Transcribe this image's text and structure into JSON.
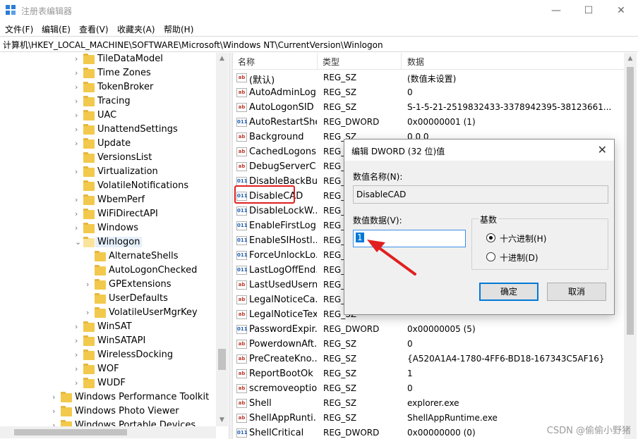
{
  "window": {
    "title": "注册表编辑器",
    "minimize": "—",
    "maximize": "☐",
    "close": "✕"
  },
  "menu": [
    "文件(F)",
    "编辑(E)",
    "查看(V)",
    "收藏夹(A)",
    "帮助(H)"
  ],
  "address": "计算机\\HKEY_LOCAL_MACHINE\\SOFTWARE\\Microsoft\\Windows NT\\CurrentVersion\\Winlogon",
  "tree": [
    {
      "label": "TileDataModel",
      "depth": 2,
      "expandable": true
    },
    {
      "label": "Time Zones",
      "depth": 2,
      "expandable": true
    },
    {
      "label": "TokenBroker",
      "depth": 2,
      "expandable": true
    },
    {
      "label": "Tracing",
      "depth": 2,
      "expandable": true
    },
    {
      "label": "UAC",
      "depth": 2,
      "expandable": true
    },
    {
      "label": "UnattendSettings",
      "depth": 2,
      "expandable": true
    },
    {
      "label": "Update",
      "depth": 2,
      "expandable": true
    },
    {
      "label": "VersionsList",
      "depth": 2,
      "expandable": false
    },
    {
      "label": "Virtualization",
      "depth": 2,
      "expandable": true
    },
    {
      "label": "VolatileNotifications",
      "depth": 2,
      "expandable": false
    },
    {
      "label": "WbemPerf",
      "depth": 2,
      "expandable": true
    },
    {
      "label": "WiFiDirectAPI",
      "depth": 2,
      "expandable": true
    },
    {
      "label": "Windows",
      "depth": 2,
      "expandable": true
    },
    {
      "label": "Winlogon",
      "depth": 2,
      "expandable": true,
      "expanded": true,
      "selected": true
    },
    {
      "label": "AlternateShells",
      "depth": 3,
      "expandable": false
    },
    {
      "label": "AutoLogonChecked",
      "depth": 3,
      "expandable": false
    },
    {
      "label": "GPExtensions",
      "depth": 3,
      "expandable": true
    },
    {
      "label": "UserDefaults",
      "depth": 3,
      "expandable": false
    },
    {
      "label": "VolatileUserMgrKey",
      "depth": 3,
      "expandable": true
    },
    {
      "label": "WinSAT",
      "depth": 2,
      "expandable": true
    },
    {
      "label": "WinSATAPI",
      "depth": 2,
      "expandable": true
    },
    {
      "label": "WirelessDocking",
      "depth": 2,
      "expandable": true
    },
    {
      "label": "WOF",
      "depth": 2,
      "expandable": true
    },
    {
      "label": "WUDF",
      "depth": 2,
      "expandable": true
    },
    {
      "label": "Windows Performance Toolkit",
      "depth": 1,
      "expandable": true
    },
    {
      "label": "Windows Photo Viewer",
      "depth": 1,
      "expandable": true
    },
    {
      "label": "Windows Portable Devices",
      "depth": 1,
      "expandable": true
    }
  ],
  "list": {
    "headers": {
      "name": "名称",
      "type": "类型",
      "data": "数据"
    },
    "rows": [
      {
        "name": "(默认)",
        "type": "REG_SZ",
        "data": "(数值未设置)",
        "kind": "sz"
      },
      {
        "name": "AutoAdminLog...",
        "type": "REG_SZ",
        "data": "0",
        "kind": "sz"
      },
      {
        "name": "AutoLogonSID",
        "type": "REG_SZ",
        "data": "S-1-5-21-2519832433-3378942395-38123661...",
        "kind": "sz"
      },
      {
        "name": "AutoRestartShell",
        "type": "REG_DWORD",
        "data": "0x00000001 (1)",
        "kind": "bin"
      },
      {
        "name": "Background",
        "type": "REG_SZ",
        "data": "0 0 0",
        "kind": "sz"
      },
      {
        "name": "CachedLogons...",
        "type": "REG_SZ",
        "data": "",
        "kind": "sz"
      },
      {
        "name": "DebugServerC...",
        "type": "REG_SZ",
        "data": "",
        "kind": "sz"
      },
      {
        "name": "DisableBackBu...",
        "type": "REG_DWORD",
        "data": "",
        "kind": "bin"
      },
      {
        "name": "DisableCAD",
        "type": "REG_DWORD",
        "data": "",
        "kind": "bin"
      },
      {
        "name": "DisableLockW...",
        "type": "REG_DWORD",
        "data": "",
        "kind": "bin"
      },
      {
        "name": "EnableFirstLog...",
        "type": "REG_DWORD",
        "data": "",
        "kind": "bin"
      },
      {
        "name": "EnableSIHostl...",
        "type": "REG_DWORD",
        "data": "",
        "kind": "bin"
      },
      {
        "name": "ForceUnlockLo...",
        "type": "REG_DWORD",
        "data": "",
        "kind": "bin"
      },
      {
        "name": "LastLogOffEnd...",
        "type": "REG_QWORD",
        "data": "",
        "kind": "bin"
      },
      {
        "name": "LastUsedUsern...",
        "type": "REG_SZ",
        "data": "",
        "kind": "sz"
      },
      {
        "name": "LegalNoticeCa...",
        "type": "REG_SZ",
        "data": "",
        "kind": "sz"
      },
      {
        "name": "LegalNoticeText",
        "type": "REG_SZ",
        "data": "",
        "kind": "sz"
      },
      {
        "name": "PasswordExpir...",
        "type": "REG_DWORD",
        "data": "0x00000005 (5)",
        "kind": "bin"
      },
      {
        "name": "PowerdownAft...",
        "type": "REG_SZ",
        "data": "0",
        "kind": "sz"
      },
      {
        "name": "PreCreateKno...",
        "type": "REG_SZ",
        "data": "{A520A1A4-1780-4FF6-BD18-167343C5AF16}",
        "kind": "sz"
      },
      {
        "name": "ReportBootOk",
        "type": "REG_SZ",
        "data": "1",
        "kind": "sz"
      },
      {
        "name": "scremoveoption",
        "type": "REG_SZ",
        "data": "0",
        "kind": "sz"
      },
      {
        "name": "Shell",
        "type": "REG_SZ",
        "data": "explorer.exe",
        "kind": "sz"
      },
      {
        "name": "ShellAppRunti...",
        "type": "REG_SZ",
        "data": "ShellAppRuntime.exe",
        "kind": "sz"
      },
      {
        "name": "ShellCritical",
        "type": "REG_DWORD",
        "data": "0x00000000 (0)",
        "kind": "bin"
      }
    ]
  },
  "dialog": {
    "title": "编辑 DWORD (32 位)值",
    "close": "✕",
    "name_label": "数值名称(N):",
    "name_value": "DisableCAD",
    "data_label": "数值数据(V):",
    "data_value": "1",
    "base_label": "基数",
    "radio_hex": "十六进制(H)",
    "radio_dec": "十进制(D)",
    "ok": "确定",
    "cancel": "取消"
  },
  "watermark": "CSDN @偷偷小野猪",
  "colors": {
    "accent": "#0078d7",
    "highlight": "#e02020",
    "folder": "#f2c94c"
  }
}
